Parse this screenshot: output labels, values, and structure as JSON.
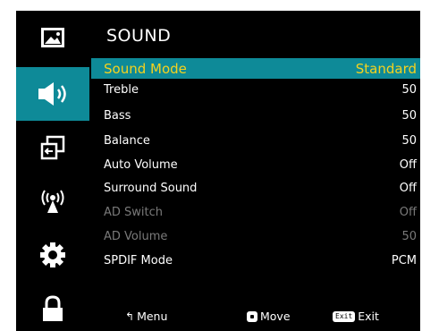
{
  "sidebar": {
    "items": [
      {
        "icon": "picture-icon",
        "active": false
      },
      {
        "icon": "speaker-icon",
        "active": true
      },
      {
        "icon": "source-input-icon",
        "active": false
      },
      {
        "icon": "broadcast-icon",
        "active": false
      },
      {
        "icon": "gear-icon",
        "active": false
      },
      {
        "icon": "lock-icon",
        "active": false
      }
    ]
  },
  "header": {
    "title": "SOUND"
  },
  "menu": {
    "items": [
      {
        "label": "Sound Mode",
        "value": "Standard",
        "state": "selected"
      },
      {
        "label": "Treble",
        "value": "50",
        "state": "normal"
      },
      {
        "label": "Bass",
        "value": "50",
        "state": "normal"
      },
      {
        "label": "Balance",
        "value": "50",
        "state": "normal"
      },
      {
        "label": "Auto Volume",
        "value": "Off",
        "state": "normal"
      },
      {
        "label": "Surround Sound",
        "value": "Off",
        "state": "normal"
      },
      {
        "label": "AD Switch",
        "value": "Off",
        "state": "disabled"
      },
      {
        "label": "AD Volume",
        "value": "50",
        "state": "disabled"
      },
      {
        "label": "SPDIF Mode",
        "value": "PCM",
        "state": "normal"
      }
    ]
  },
  "footer": {
    "menu_label": "Menu",
    "move_label": "Move",
    "exit_key": "Exit",
    "exit_label": "Exit"
  },
  "colors": {
    "highlight": "#0e8a98",
    "selected_text": "#f5d21e",
    "disabled_text": "#7a7a7a",
    "background": "#000000"
  }
}
